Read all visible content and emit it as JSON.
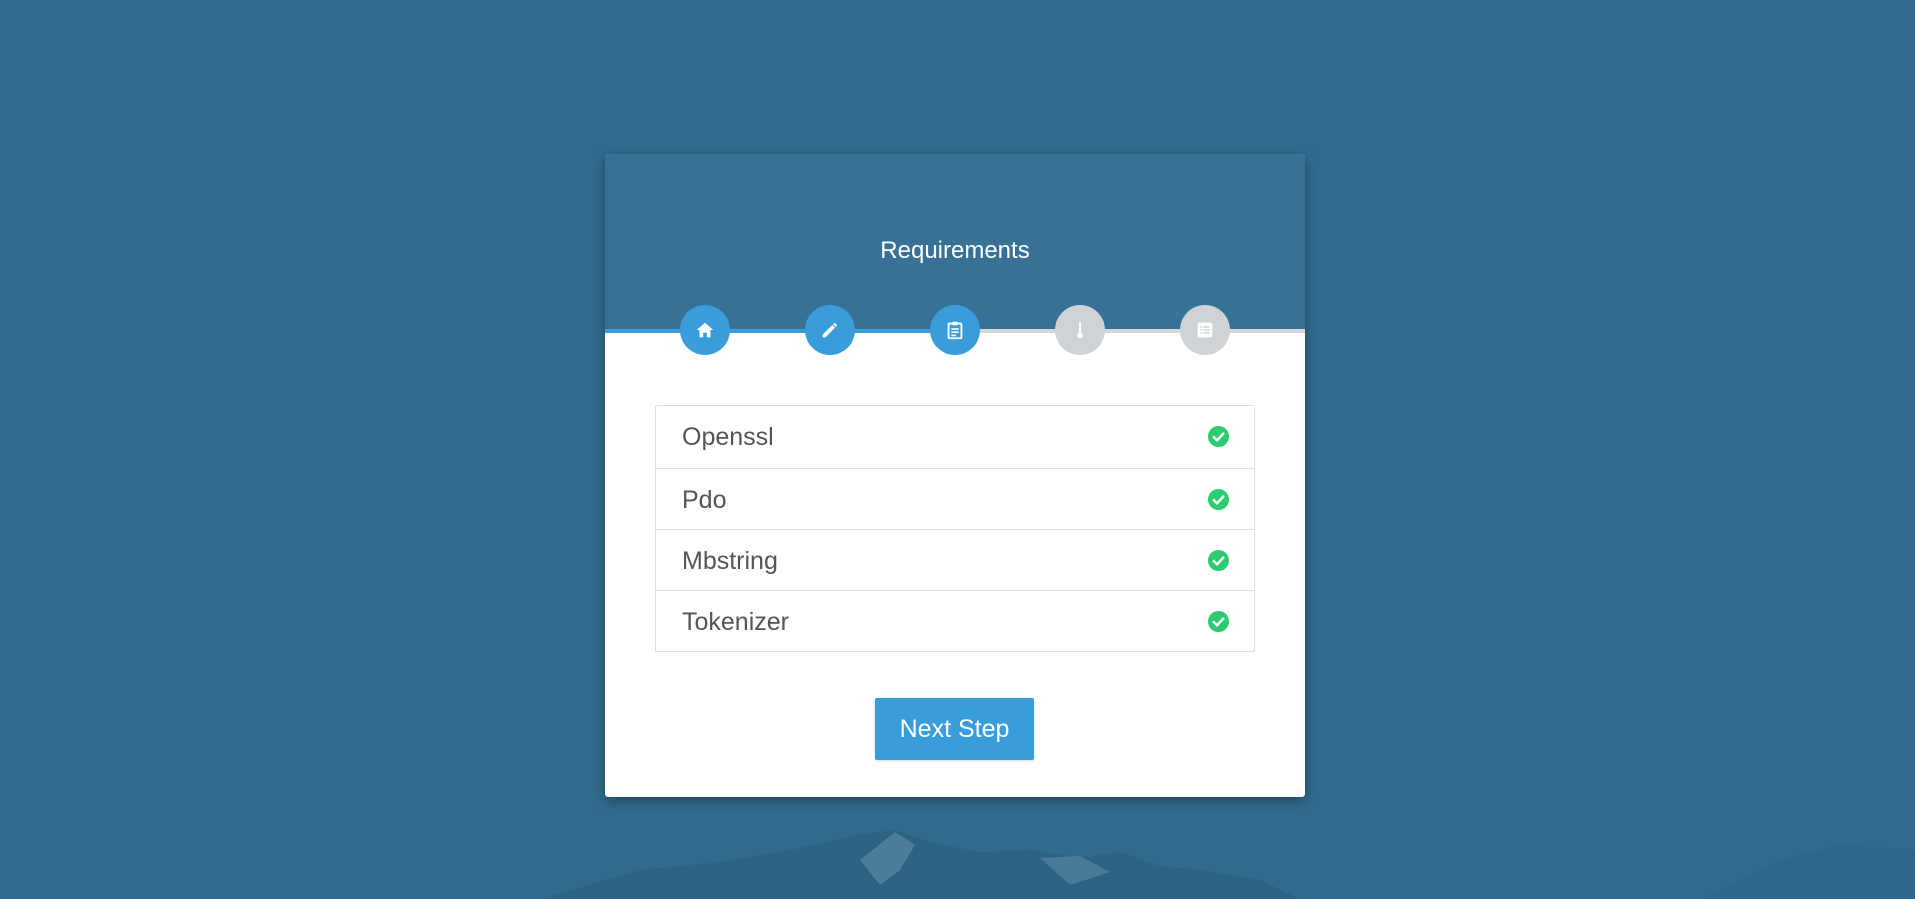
{
  "page": {
    "background_color": "#316b8c"
  },
  "card": {
    "title": "Requirements",
    "header_color": "#377296"
  },
  "stepper": {
    "active_color": "#3a9ddb",
    "inactive_color": "#cfd3d6",
    "current_step": 3,
    "total_steps": 5,
    "steps": [
      {
        "icon": "home-icon",
        "state": "completed"
      },
      {
        "icon": "pencil-icon",
        "state": "completed"
      },
      {
        "icon": "clipboard-icon",
        "state": "current"
      },
      {
        "icon": "thermometer-icon",
        "state": "pending"
      },
      {
        "icon": "list-icon",
        "state": "pending"
      }
    ]
  },
  "requirements": [
    {
      "name": "Openssl",
      "status": "ok",
      "icon": "check-circle-icon"
    },
    {
      "name": "Pdo",
      "status": "ok",
      "icon": "check-circle-icon"
    },
    {
      "name": "Mbstring",
      "status": "ok",
      "icon": "check-circle-icon"
    },
    {
      "name": "Tokenizer",
      "status": "ok",
      "icon": "check-circle-icon"
    }
  ],
  "status_color": "#2ecc71",
  "actions": {
    "next_label": "Next Step"
  }
}
